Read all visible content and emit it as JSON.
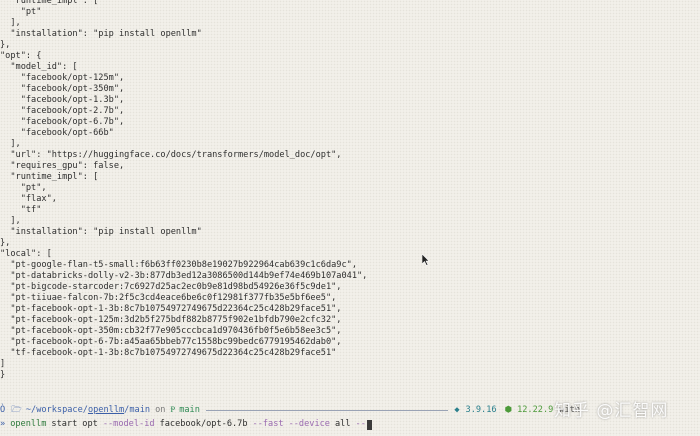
{
  "terminal_lines": [
    "  \"runtime_impl\": [",
    "    \"pt\"",
    "  ],",
    "  \"installation\": \"pip install openllm\"",
    "},",
    "\"opt\": {",
    "  \"model_id\": [",
    "    \"facebook/opt-125m\",",
    "    \"facebook/opt-350m\",",
    "    \"facebook/opt-1.3b\",",
    "    \"facebook/opt-2.7b\",",
    "    \"facebook/opt-6.7b\",",
    "    \"facebook/opt-66b\"",
    "  ],",
    "  \"url\": \"https://huggingface.co/docs/transformers/model_doc/opt\",",
    "  \"requires_gpu\": false,",
    "  \"runtime_impl\": [",
    "    \"pt\",",
    "    \"flax\",",
    "    \"tf\"",
    "  ],",
    "  \"installation\": \"pip install openllm\"",
    "},",
    "\"local\": [",
    "  \"pt-google-flan-t5-small:f6b63ff0230b8e19027b922964cab639c1c6da9c\",",
    "  \"pt-databricks-dolly-v2-3b:877db3ed12a3086500d144b9ef74e469b107a041\",",
    "  \"pt-bigcode-starcoder:7c6927d25ac2ec0b9e81d98bd54926e36f5c9de1\",",
    "  \"pt-tiiuae-falcon-7b:2f5c3cd4eace6be6c0f12981f377fb35e5bf6ee5\",",
    "  \"pt-facebook-opt-1-3b:8c7b10754972749675d22364c25c428b29face51\",",
    "  \"pt-facebook-opt-125m:3d2b5f275bdf882b8775f902e1bfdb790e2cfc32\",",
    "  \"pt-facebook-opt-350m:cb32f77e905cccbca1d970436fb0f5e6b58ee3c5\",",
    "  \"pt-facebook-opt-6-7b:a45aa65bbeb77c1558bc99bedc6779195462dab0\",",
    "  \"tf-facebook-opt-1-3b:8c7b10754972749675d22364c25c428b29face51\"",
    "]",
    "}"
  ],
  "prompt": {
    "leading_glyph": "Ò",
    "folder_icon": "folder-icon",
    "path_prefix": "~/workspace/",
    "path_dir": "openllm",
    "path_sep": "/",
    "path_tail": "main",
    "on_text": "on",
    "git_glyph": "Ᵽ",
    "branch": "main",
    "python_glyph": "◆",
    "python_version": "3.9.16",
    "node_glyph": "⬢",
    "node_version": "12.22.9",
    "with_text": "with"
  },
  "command": {
    "prefix_glyph": "»",
    "program": "openllm",
    "subcommand": "start",
    "model": "opt",
    "flag_model_id": "--model-id",
    "model_id_value": "facebook/opt-6.7b",
    "flag_fast": "--fast",
    "flag_device": "--device",
    "device_value": "all",
    "flag_trailing": "--"
  },
  "watermark": {
    "text": "知乎 @汇智网"
  },
  "colors": {
    "background": "#f2f0ea",
    "text": "#2f2f2f",
    "path": "#3b5fa8",
    "git": "#2e8a54",
    "python": "#2a7f8c",
    "node": "#4c9a3a",
    "flag": "#9a6ab0"
  }
}
